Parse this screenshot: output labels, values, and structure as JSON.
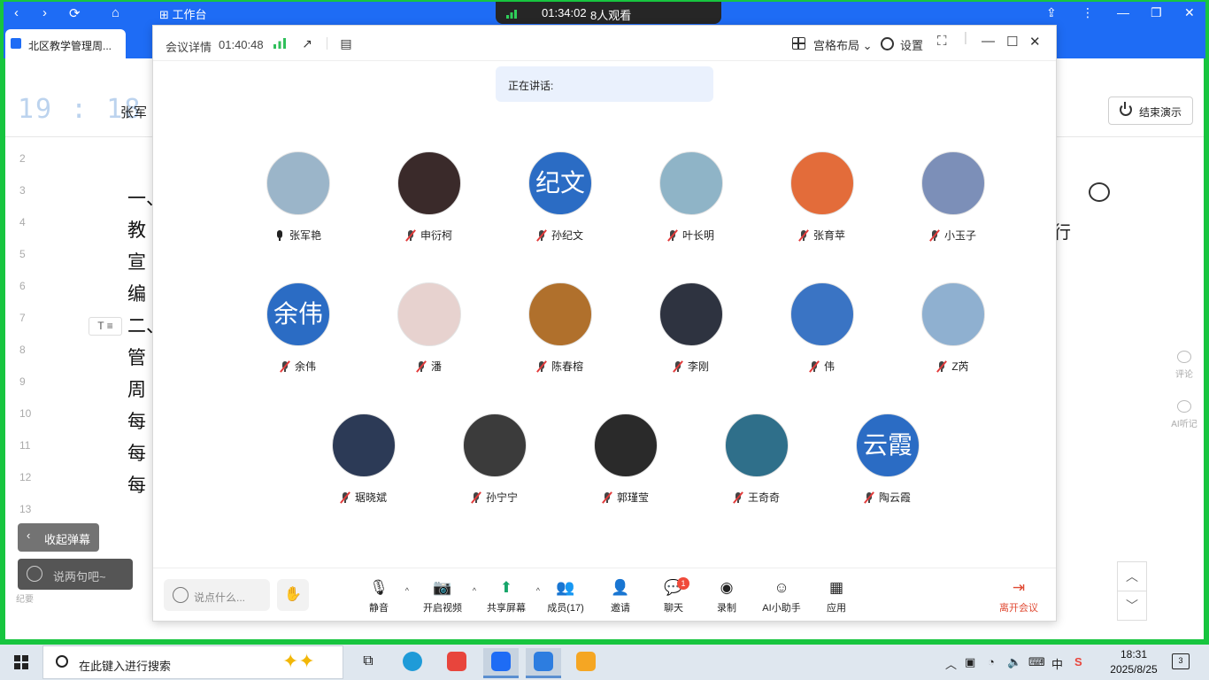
{
  "topbar": {
    "workspace": "工作台"
  },
  "live": {
    "timer": "01:34:02",
    "viewers": "8人观看"
  },
  "tab": {
    "label": "北区教学管理周..."
  },
  "doc": {
    "clock": "19 : 18",
    "author": "张军",
    "end_label": "结束演示",
    "line_numbers": [
      "2",
      "3",
      "4",
      "5",
      "6",
      "7",
      "8",
      "9",
      "10",
      "11",
      "12",
      "13"
    ],
    "line_chars": [
      "一、",
      "教",
      "宣",
      "编",
      "二、",
      "管",
      "周",
      "每",
      "每",
      "每"
    ],
    "right_char": "行",
    "textbox": "T ≡",
    "side_comment": "评论",
    "side_ai": "AI听记",
    "danmu_collapse": "收起弹幕",
    "danmu_say": "说两句吧~",
    "side_bottom": "纪要"
  },
  "meeting": {
    "title": "会议详情",
    "timer": "01:40:48",
    "layout_label": "宫格布局",
    "settings_label": "设置",
    "speaking_label": "正在讲话:",
    "participants": [
      {
        "name": "张军艳",
        "muted": false,
        "color": "#9bb5c9"
      },
      {
        "name": "申衍柯",
        "muted": true,
        "color": "#3a2a2a"
      },
      {
        "name": "孙纪文",
        "muted": true,
        "color": "#2b6cc4",
        "initials": "纪文"
      },
      {
        "name": "叶长明",
        "muted": true,
        "color": "#8fb4c7"
      },
      {
        "name": "张育苹",
        "muted": true,
        "color": "#e36c3a"
      },
      {
        "name": "小玉子",
        "muted": true,
        "color": "#7c8fb8"
      },
      {
        "name": "余伟",
        "muted": true,
        "color": "#2b6cc4",
        "initials": "余伟"
      },
      {
        "name": "潘",
        "muted": true,
        "color": "#e7d2cf"
      },
      {
        "name": "陈春榕",
        "muted": true,
        "color": "#b0702c"
      },
      {
        "name": "李刚",
        "muted": true,
        "color": "#2e3340"
      },
      {
        "name": "伟",
        "muted": true,
        "color": "#3a74c4"
      },
      {
        "name": "Z芮",
        "muted": true,
        "color": "#8fb0d0"
      },
      {
        "name": "琚晓斌",
        "muted": true,
        "color": "#2c3a56"
      },
      {
        "name": "孙宁宁",
        "muted": true,
        "color": "#3b3b3b"
      },
      {
        "name": "郭瑾莹",
        "muted": true,
        "color": "#2a2a2a"
      },
      {
        "name": "王奇奇",
        "muted": true,
        "color": "#2f6f8a"
      },
      {
        "name": "陶云霞",
        "muted": true,
        "color": "#2b6cc4",
        "initials": "云霞"
      }
    ],
    "chat_placeholder": "说点什么...",
    "toolbar": {
      "mute": "静音",
      "video": "开启视频",
      "share": "共享屏幕",
      "members": "成员(17)",
      "invite": "邀请",
      "chat": "聊天",
      "chat_badge": "1",
      "record": "录制",
      "ai": "AI小助手",
      "apps": "应用",
      "leave": "离开会议"
    }
  },
  "taskbar": {
    "search_placeholder": "在此键入进行搜索",
    "ime": "中",
    "time": "18:31",
    "date": "2025/8/25",
    "notifications": "3"
  }
}
